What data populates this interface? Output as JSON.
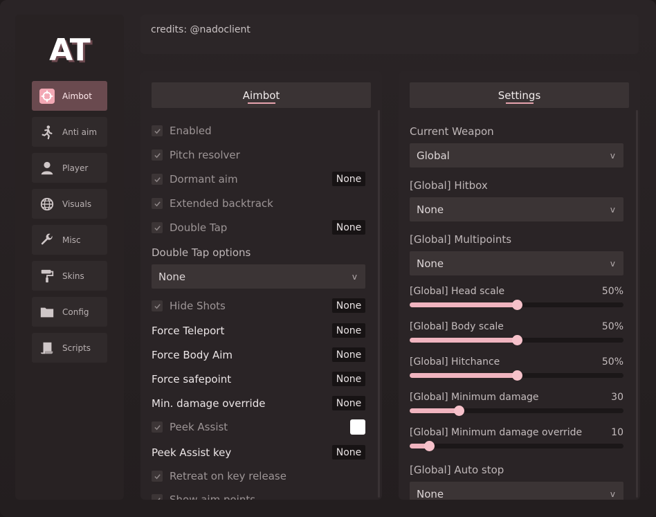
{
  "logo": "AT",
  "sidebar": {
    "items": [
      {
        "label": "Aimbot",
        "icon": "crosshair-icon",
        "active": true
      },
      {
        "label": "Anti aim",
        "icon": "running-person-icon",
        "active": false
      },
      {
        "label": "Player",
        "icon": "person-icon",
        "active": false
      },
      {
        "label": "Visuals",
        "icon": "globe-icon",
        "active": false
      },
      {
        "label": "Misc",
        "icon": "wrench-icon",
        "active": false
      },
      {
        "label": "Skins",
        "icon": "paint-roller-icon",
        "active": false
      },
      {
        "label": "Config",
        "icon": "folder-icon",
        "active": false
      },
      {
        "label": "Scripts",
        "icon": "scroll-icon",
        "active": false
      }
    ]
  },
  "credits": "credits: @nadoclient",
  "aimbot": {
    "title": "Aimbot",
    "enabled": "Enabled",
    "pitch_resolver": "Pitch resolver",
    "dormant_aim": "Dormant aim",
    "dormant_aim_key": "None",
    "extended_backtrack": "Extended backtrack",
    "double_tap": "Double Tap",
    "double_tap_key": "None",
    "double_tap_options_label": "Double Tap options",
    "double_tap_options_value": "None",
    "hide_shots": "Hide Shots",
    "hide_shots_key": "None",
    "force_teleport": "Force Teleport",
    "force_teleport_key": "None",
    "force_body_aim": "Force Body Aim",
    "force_body_aim_key": "None",
    "force_safepoint": "Force safepoint",
    "force_safepoint_key": "None",
    "min_damage_override": "Min. damage override",
    "min_damage_override_key": "None",
    "peek_assist": "Peek Assist",
    "peek_assist_color": "#ffffff",
    "peek_assist_key_label": "Peek Assist key",
    "peek_assist_key": "None",
    "retreat": "Retreat on key release",
    "show_aim_points": "Show aim points"
  },
  "settings": {
    "title": "Settings",
    "current_weapon_label": "Current Weapon",
    "current_weapon_value": "Global",
    "hitbox_label": "[Global] Hitbox",
    "hitbox_value": "None",
    "multipoints_label": "[Global] Multipoints",
    "multipoints_value": "None",
    "head_scale_label": "[Global] Head scale",
    "head_scale_value": "50%",
    "body_scale_label": "[Global] Body scale",
    "body_scale_value": "50%",
    "hitchance_label": "[Global] Hitchance",
    "hitchance_value": "50%",
    "min_damage_label": "[Global] Minimum damage",
    "min_damage_value": "30",
    "min_damage_override_label": "[Global] Minimum damage override",
    "min_damage_override_value": "10",
    "auto_stop_label": "[Global] Auto stop",
    "auto_stop_value": "None",
    "chevron": "v"
  },
  "sliders": {
    "head_scale": 0.5,
    "body_scale": 0.5,
    "hitchance": 0.5,
    "min_damage": 0.23,
    "min_damage_override": 0.09
  },
  "colors": {
    "accent": "#f0b4bf",
    "active_nav": "#6a4a4f"
  }
}
